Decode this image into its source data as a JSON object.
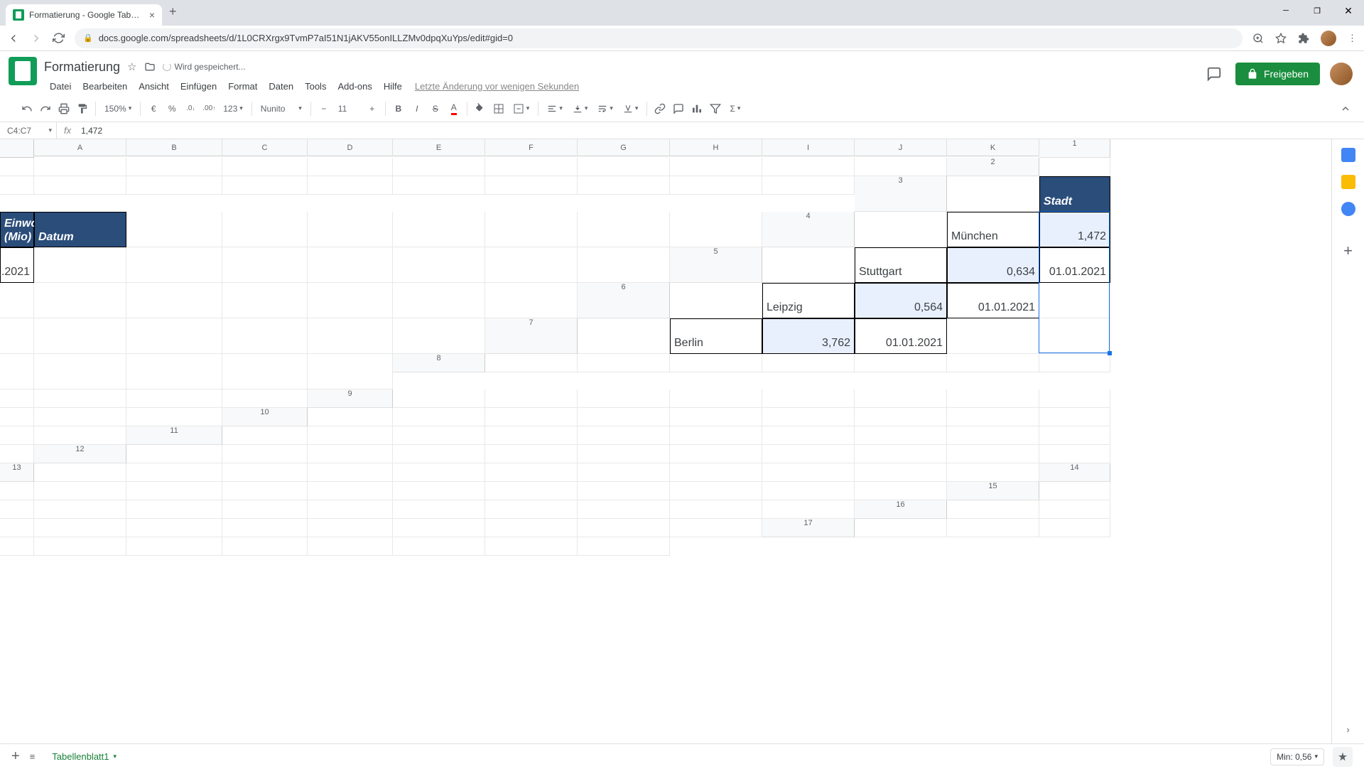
{
  "browser": {
    "tab_title": "Formatierung - Google Tabellen",
    "url": "docs.google.com/spreadsheets/d/1L0CRXrgx9TvmP7aI51N1jAKV55onILLZMv0dpqXuYps/edit#gid=0"
  },
  "header": {
    "doc_title": "Formatierung",
    "saving_text": "Wird gespeichert...",
    "menus": [
      "Datei",
      "Bearbeiten",
      "Ansicht",
      "Einfügen",
      "Format",
      "Daten",
      "Tools",
      "Add-ons",
      "Hilfe"
    ],
    "last_edit": "Letzte Änderung vor wenigen Sekunden",
    "share_label": "Freigeben"
  },
  "toolbar": {
    "zoom": "150%",
    "currency": "€",
    "percent": "%",
    "dec_less": ".0",
    "dec_more": ".00",
    "numfmt": "123",
    "font": "Nunito",
    "size": "11"
  },
  "formula": {
    "namebox": "C4:C7",
    "fx": "fx",
    "value": "1,472"
  },
  "columns": [
    "A",
    "B",
    "C",
    "D",
    "E",
    "F",
    "G",
    "H",
    "I",
    "J",
    "K"
  ],
  "row_count": 17,
  "table": {
    "headers": {
      "stadt": "Stadt",
      "einwohner": "Einwohner (Mio)",
      "datum": "Datum"
    },
    "rows": [
      {
        "stadt": "München",
        "einwohner": "1,472",
        "datum": "01.01.2021"
      },
      {
        "stadt": "Stuttgart",
        "einwohner": "0,634",
        "datum": "01.01.2021"
      },
      {
        "stadt": "Leipzig",
        "einwohner": "0,564",
        "datum": "01.01.2021"
      },
      {
        "stadt": "Berlin",
        "einwohner": "3,762",
        "datum": "01.01.2021"
      }
    ]
  },
  "selection": "C4:C7",
  "bottom": {
    "sheet_name": "Tabellenblatt1",
    "stat": "Min: 0,56"
  }
}
